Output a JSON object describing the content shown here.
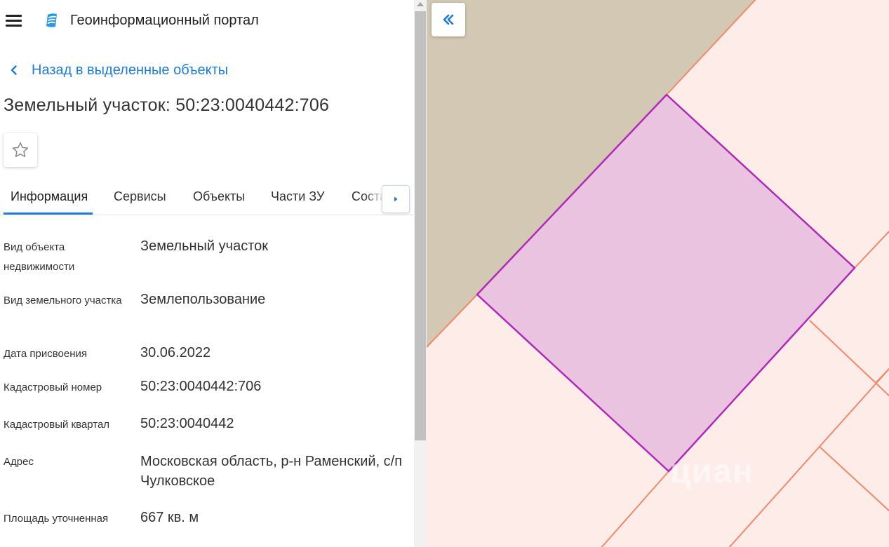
{
  "app": {
    "title": "Геоинформационный портал"
  },
  "nav": {
    "back_label": "Назад в выделенные объекты"
  },
  "object": {
    "title": "Земельный участок: 50:23:0040442:706"
  },
  "tabs": [
    {
      "label": "Информация"
    },
    {
      "label": "Сервисы"
    },
    {
      "label": "Объекты"
    },
    {
      "label": "Части ЗУ"
    },
    {
      "label": "Соста"
    }
  ],
  "info": [
    {
      "label": "Вид объекта недвижимости",
      "value": "Земельный участок"
    },
    {
      "label": "Вид земельного участка",
      "value": "Землепользование"
    },
    {
      "label": "Дата присвоения",
      "value": "30.06.2022"
    },
    {
      "label": "Кадастровый номер",
      "value": "50:23:0040442:706"
    },
    {
      "label": "Кадастровый квартал",
      "value": "50:23:0040442"
    },
    {
      "label": "Адрес",
      "value": "Московская область, р-н Раменский, с/п Чулковское"
    },
    {
      "label": "Площадь уточненная",
      "value": "667 кв. м"
    }
  ],
  "map": {
    "watermark": "циан"
  },
  "colors": {
    "accent": "#1e7bd6",
    "parcel_fill": "#e9c3e0",
    "parcel_stroke": "#b02ab8",
    "neighbor_fill": "#d2c8b3",
    "boundary_line": "#f08a6a",
    "map_background": "#fdece7"
  },
  "icons": {
    "menu": "hamburger-icon",
    "logo": "portal-logo-icon",
    "back": "chevron-left-icon",
    "favorite": "star-outline-icon",
    "tab_scroll": "caret-right-icon",
    "collapse": "double-chevron-left-icon"
  }
}
